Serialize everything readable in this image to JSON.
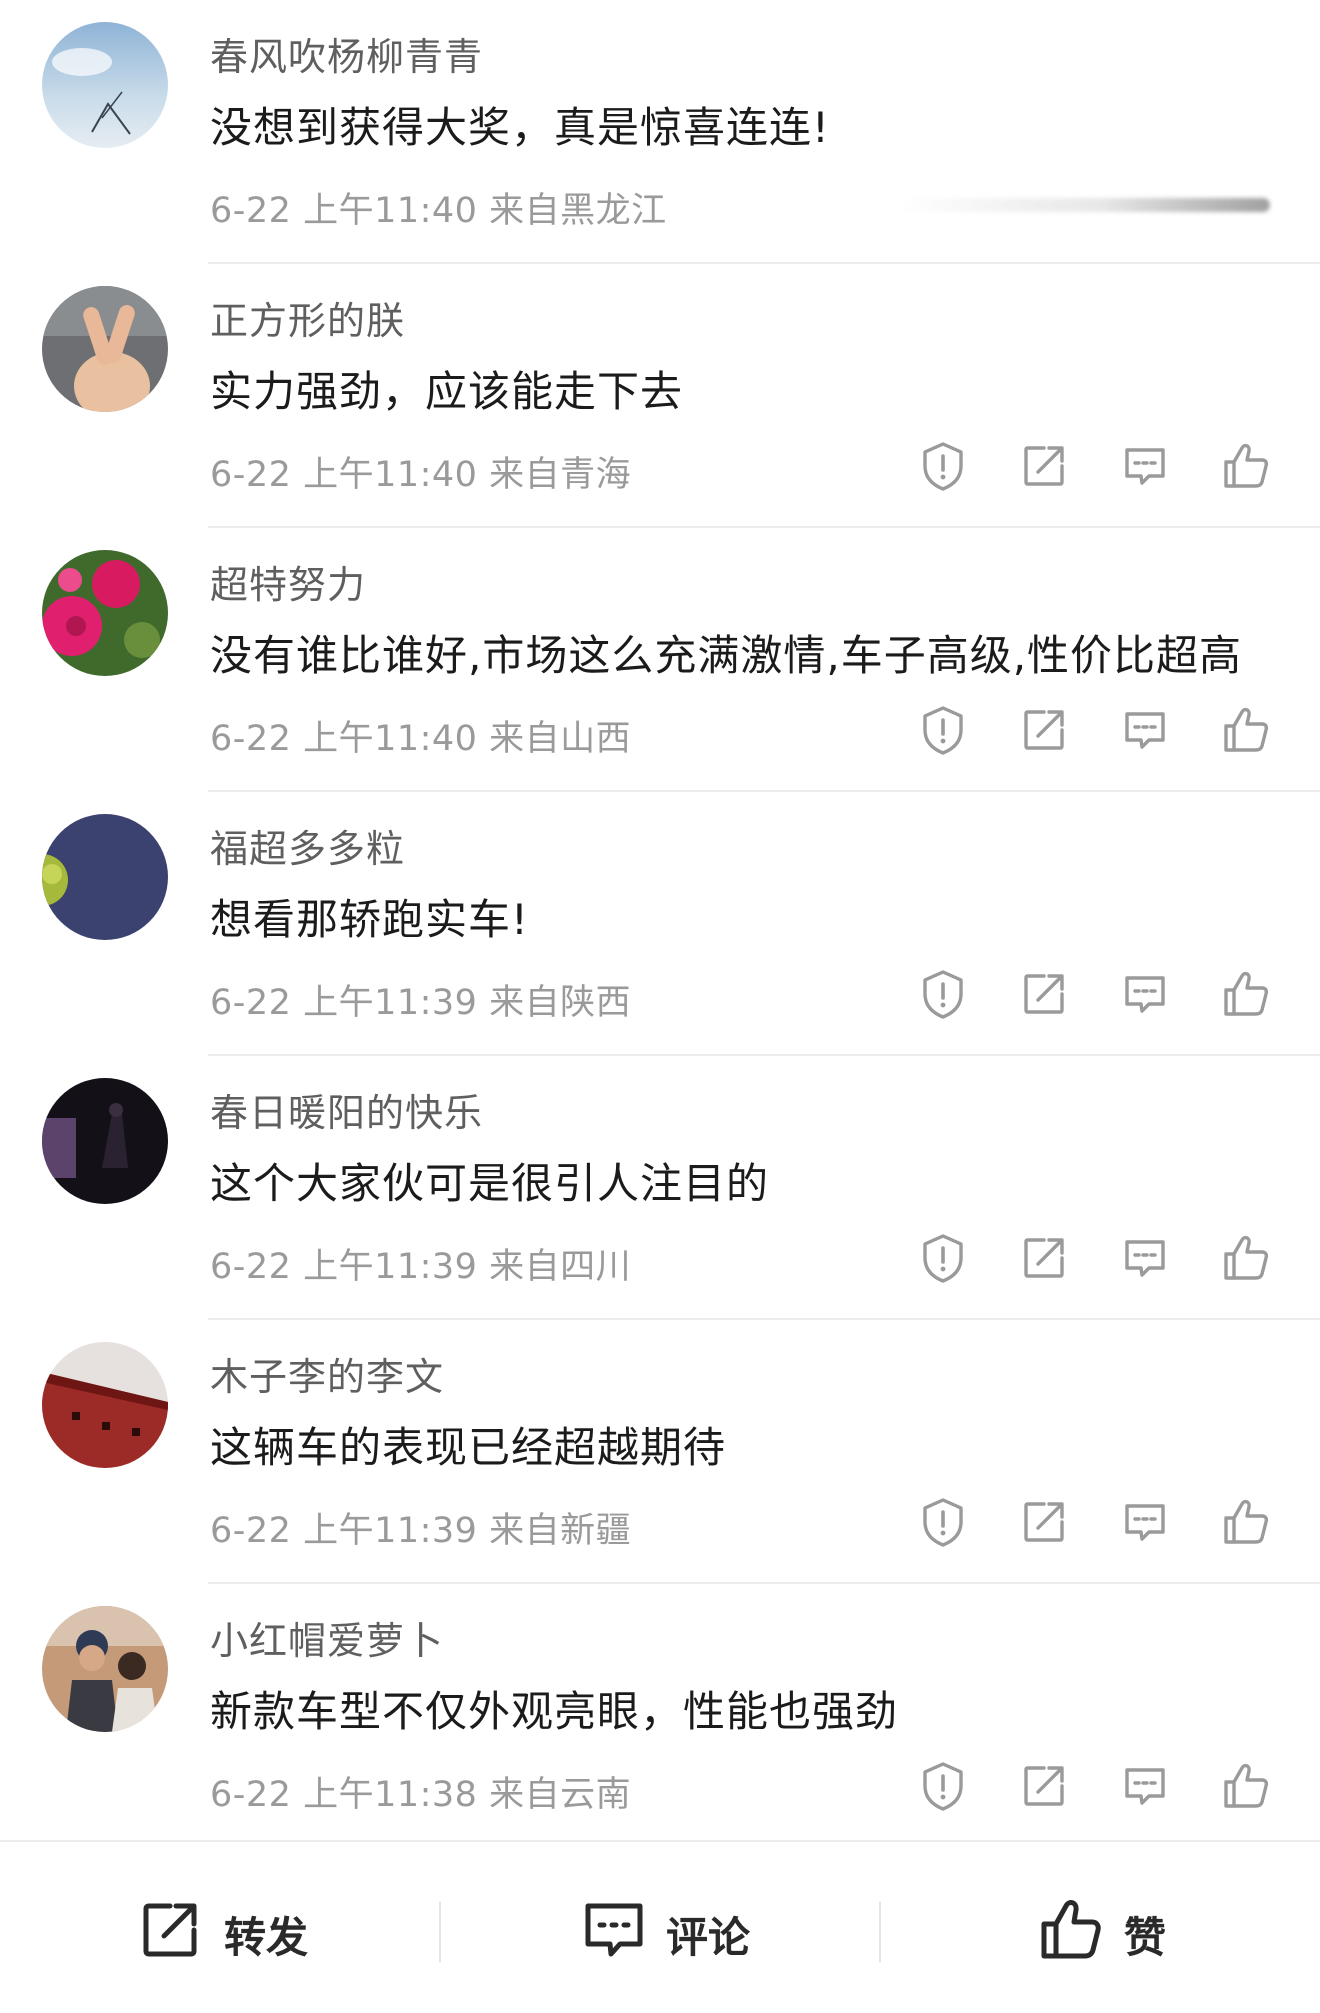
{
  "comments": [
    {
      "user": "春风吹杨柳青青",
      "text": "没想到获得大奖，真是惊喜连连!",
      "date": "6-22",
      "time": "上午11:40",
      "location": "来自黑龙江"
    },
    {
      "user": "正方形的朕",
      "text": "实力强劲，应该能走下去",
      "date": "6-22",
      "time": "上午11:40",
      "location": "来自青海"
    },
    {
      "user": "超特努力",
      "text": "没有谁比谁好,市场这么充满激情,车子高级,性价比超高",
      "date": "6-22",
      "time": "上午11:40",
      "location": "来自山西"
    },
    {
      "user": "福超多多粒",
      "text": "想看那轿跑实车!",
      "date": "6-22",
      "time": "上午11:39",
      "location": "来自陕西"
    },
    {
      "user": "春日暖阳的快乐",
      "text": "这个大家伙可是很引人注目的",
      "date": "6-22",
      "time": "上午11:39",
      "location": "来自四川"
    },
    {
      "user": "木子李的李文",
      "text": "这辆车的表现已经超越期待",
      "date": "6-22",
      "time": "上午11:39",
      "location": "来自新疆"
    },
    {
      "user": "小红帽爱萝卜",
      "text": "新款车型不仅外观亮眼，性能也强劲",
      "date": "6-22",
      "time": "上午11:38",
      "location": "来自云南"
    }
  ],
  "bottom_bar": {
    "forward_label": "转发",
    "comment_label": "评论",
    "like_label": "赞"
  },
  "icons": {
    "report": "shield-exclamation-icon",
    "repost": "share-square-icon",
    "reply": "comment-bubble-icon",
    "like": "thumbs-up-icon"
  },
  "colors": {
    "name": "#5f5f5f",
    "text": "#1b1b1b",
    "meta": "#9a9a9a",
    "icon": "#9a9a9a",
    "divider": "#ececec"
  }
}
